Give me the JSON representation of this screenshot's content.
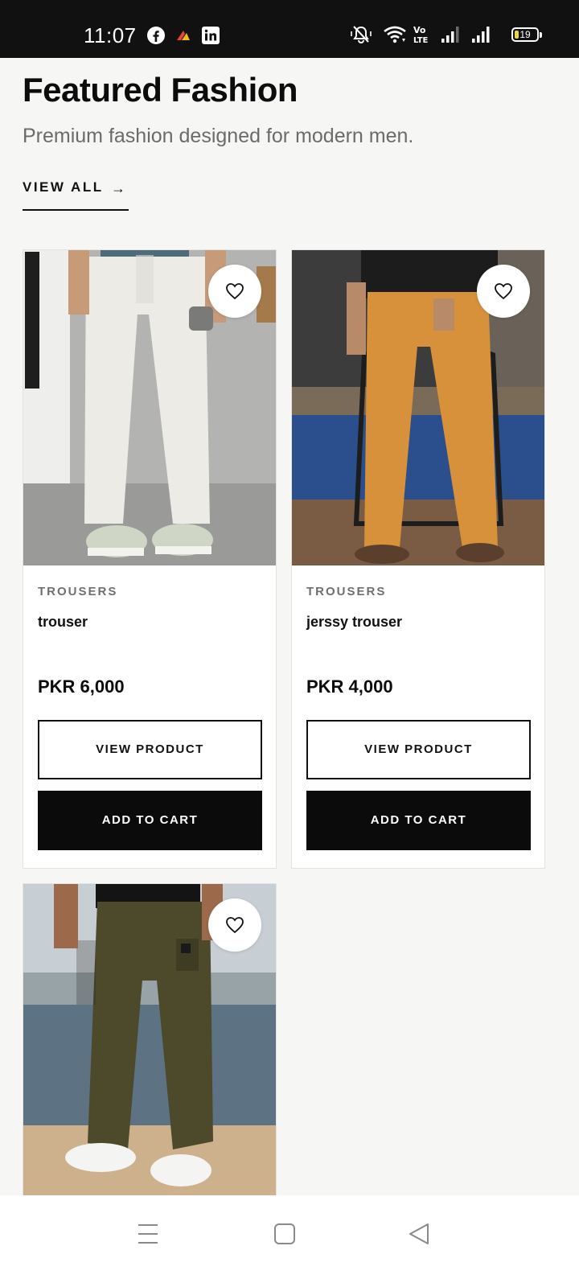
{
  "status_bar": {
    "time": "11:07",
    "battery_level": "19",
    "battery_fraction": 0.19,
    "left_icons": [
      "facebook-icon",
      "app-notification-icon",
      "linkedin-icon"
    ],
    "right_icons": [
      "mute-icon",
      "wifi-icon",
      "volte-icon",
      "signal-icon",
      "signal-icon",
      "battery-icon"
    ]
  },
  "header": {
    "title": "Featured Fashion",
    "subtitle": "Premium fashion designed for modern men.",
    "view_all_label": "VIEW ALL",
    "view_all_arrow": "→"
  },
  "products": [
    {
      "category": "TROUSERS",
      "name": "trouser",
      "price": "PKR 6,000",
      "view_label": "VIEW PRODUCT",
      "cart_label": "ADD TO CART",
      "pants_color": "#ecebe6"
    },
    {
      "category": "TROUSERS",
      "name": "jerssy trouser",
      "price": "PKR 4,000",
      "view_label": "VIEW PRODUCT",
      "cart_label": "ADD TO CART",
      "pants_color": "#d7913b"
    },
    {
      "pants_color": "#4d4a2c"
    }
  ],
  "nav_bar": {
    "icons": [
      "menu-icon",
      "home-square-icon",
      "back-triangle-icon"
    ]
  },
  "colors": {
    "background": "#f6f6f5",
    "status_bar": "#111111",
    "primary_button": "#0b0b0b",
    "muted_text": "#6b6b6b"
  }
}
